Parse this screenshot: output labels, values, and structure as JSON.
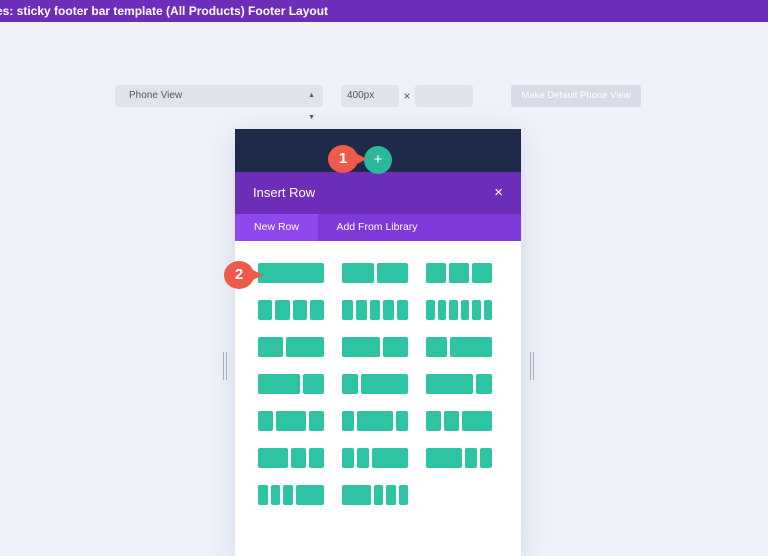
{
  "topbar": {
    "title": "es: sticky footer bar template (All Products) Footer Layout"
  },
  "toolbar": {
    "view_select": "Phone View",
    "width_value": "400px",
    "times_symbol": "×",
    "height_value": "",
    "default_button": "Make Default Phone View"
  },
  "modal": {
    "title": "Insert Row",
    "close_icon": "×",
    "tabs": [
      "New Row",
      "Add From Library"
    ]
  },
  "add_button": {
    "icon": "+"
  },
  "callouts": [
    "1",
    "2"
  ],
  "row_layouts": [
    {
      "name": "1",
      "cols": [
        1
      ]
    },
    {
      "name": "1/2 + 1/2",
      "cols": [
        1,
        1
      ]
    },
    {
      "name": "1/3 + 1/3 + 1/3",
      "cols": [
        1,
        1,
        1
      ]
    },
    {
      "name": "1/4 x 4",
      "cols": [
        1,
        1,
        1,
        1
      ]
    },
    {
      "name": "1/5 x 5",
      "cols": [
        1,
        1,
        1,
        1,
        1
      ]
    },
    {
      "name": "1/6 x 6",
      "cols": [
        1,
        1,
        1,
        1,
        1,
        1
      ]
    },
    {
      "name": "2/5 + 3/5",
      "cols": [
        2,
        3
      ]
    },
    {
      "name": "3/5 + 2/5",
      "cols": [
        3,
        2
      ]
    },
    {
      "name": "1/3 + 2/3",
      "cols": [
        1,
        2
      ]
    },
    {
      "name": "2/3 + 1/3",
      "cols": [
        2,
        1
      ]
    },
    {
      "name": "1/4 + 3/4",
      "cols": [
        1,
        3
      ]
    },
    {
      "name": "3/4 + 1/4",
      "cols": [
        3,
        1
      ]
    },
    {
      "name": "1/4 + 1/2 + 1/4",
      "cols": [
        1,
        2,
        1
      ]
    },
    {
      "name": "1/5 + 3/5 + 1/5",
      "cols": [
        1,
        3,
        1
      ]
    },
    {
      "name": "1/4 + 1/4 + 1/2",
      "cols": [
        1,
        1,
        2
      ]
    },
    {
      "name": "1/2 + 1/4 + 1/4",
      "cols": [
        2,
        1,
        1
      ]
    },
    {
      "name": "1/5 + 1/5 + 3/5",
      "cols": [
        1,
        1,
        3
      ]
    },
    {
      "name": "3/5 + 1/5 + 1/5",
      "cols": [
        3,
        1,
        1
      ]
    },
    {
      "name": "1/6 + 1/6 + 1/6 + 1/2",
      "cols": [
        1,
        1,
        1,
        3
      ]
    },
    {
      "name": "1/2 + 1/6 + 1/6 + 1/6",
      "cols": [
        3,
        1,
        1,
        1
      ]
    }
  ],
  "colors": {
    "purple": "#6c2eb9",
    "tab_bar": "#7d3ad9",
    "tab_active": "#8f47ee",
    "column_green": "#2ec4a3",
    "callout_red": "#ef5a4a",
    "phone_header": "#1f2a4b"
  }
}
